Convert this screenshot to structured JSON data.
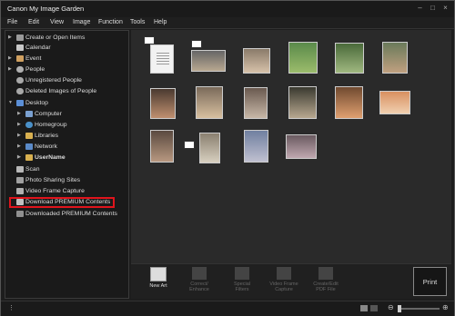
{
  "window": {
    "title": "Canon My Image Garden"
  },
  "menu": [
    "File",
    "Edit",
    "View",
    "Image",
    "Function",
    "Tools",
    "Help"
  ],
  "sidebar": {
    "items": [
      {
        "label": "Create or Open Items",
        "icon": "create-items-icon"
      },
      {
        "label": "Calendar",
        "icon": "calendar-icon"
      },
      {
        "label": "Event",
        "icon": "event-icon"
      },
      {
        "label": "People",
        "icon": "people-icon"
      },
      {
        "label": "Unregistered People",
        "icon": "person-icon"
      },
      {
        "label": "Deleted Images of People",
        "icon": "person-icon"
      },
      {
        "label": "Desktop",
        "icon": "folder-icon"
      },
      {
        "label": "Computer",
        "icon": "computer-icon"
      },
      {
        "label": "Homegroup",
        "icon": "homegroup-icon"
      },
      {
        "label": "Libraries",
        "icon": "libraries-icon"
      },
      {
        "label": "Network",
        "icon": "network-icon"
      },
      {
        "label": "UserName",
        "icon": "user-folder-icon"
      },
      {
        "label": "Scan",
        "icon": "scan-icon"
      },
      {
        "label": "Photo Sharing Sites",
        "icon": "photo-sharing-icon"
      },
      {
        "label": "Video Frame Capture",
        "icon": "video-frame-icon"
      },
      {
        "label": "Download PREMIUM Contents",
        "icon": "download-icon"
      },
      {
        "label": "Downloaded PREMIUM Contents",
        "icon": "downloaded-icon"
      }
    ]
  },
  "toolbar": {
    "new_art": "New Art",
    "correct_enhance": "Correct/\nEnhance",
    "special_filters": "Special\nFilters",
    "video_frame_capture": "Video Frame\nCapture",
    "create_edit_pdf": "Create/Edit\nPDF File",
    "print": "Print"
  },
  "colors": {
    "highlight_border": "#e0141c",
    "background": "#1d1d1d"
  }
}
